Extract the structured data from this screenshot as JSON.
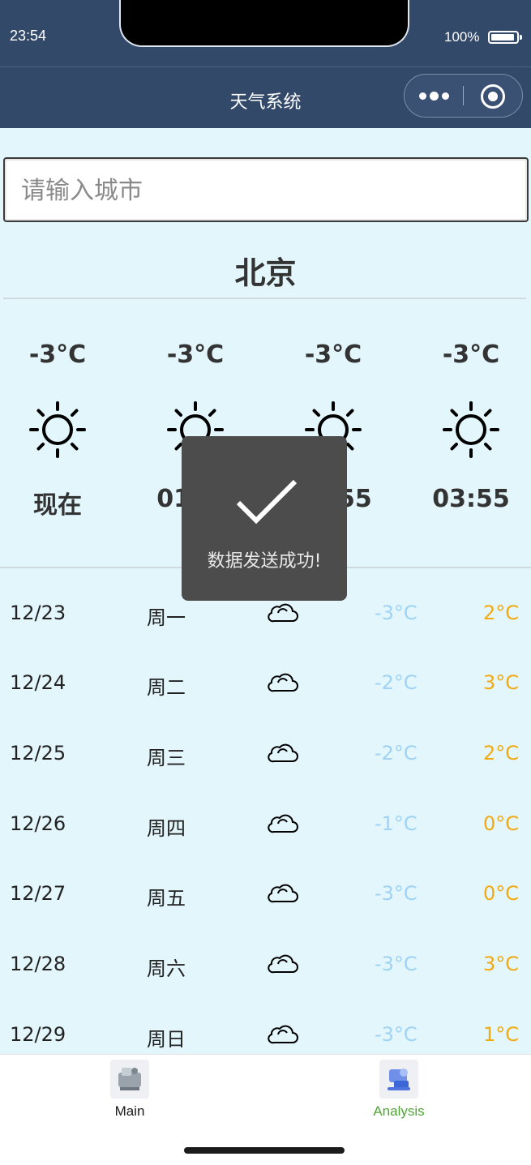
{
  "status_bar": {
    "time": "23:54",
    "battery": "100%"
  },
  "nav": {
    "title": "天气系统"
  },
  "search": {
    "placeholder": "请输入城市"
  },
  "city": "北京",
  "hourly": [
    {
      "temp": "-3°C",
      "icon": "sun-icon",
      "time": "现在"
    },
    {
      "temp": "-3°C",
      "icon": "sun-icon",
      "time": "01:55"
    },
    {
      "temp": "-3°C",
      "icon": "sun-icon",
      "time": "02:55"
    },
    {
      "temp": "-3°C",
      "icon": "sun-icon",
      "time": "03:55"
    }
  ],
  "daily": [
    {
      "date": "12/23",
      "weekday": "周一",
      "icon": "cloud-icon",
      "low": "-3°C",
      "high": "2°C"
    },
    {
      "date": "12/24",
      "weekday": "周二",
      "icon": "cloud-icon",
      "low": "-2°C",
      "high": "3°C"
    },
    {
      "date": "12/25",
      "weekday": "周三",
      "icon": "cloud-icon",
      "low": "-2°C",
      "high": "2°C"
    },
    {
      "date": "12/26",
      "weekday": "周四",
      "icon": "cloud-icon",
      "low": "-1°C",
      "high": "0°C"
    },
    {
      "date": "12/27",
      "weekday": "周五",
      "icon": "cloud-icon",
      "low": "-3°C",
      "high": "0°C"
    },
    {
      "date": "12/28",
      "weekday": "周六",
      "icon": "cloud-icon",
      "low": "-3°C",
      "high": "3°C"
    },
    {
      "date": "12/29",
      "weekday": "周日",
      "icon": "cloud-icon",
      "low": "-3°C",
      "high": "1°C"
    }
  ],
  "toast": {
    "message": "数据发送成功!"
  },
  "tabbar": [
    {
      "label": "Main",
      "icon": "main-tab-icon",
      "color": "#1a1a1a"
    },
    {
      "label": "Analysis",
      "icon": "analysis-tab-icon",
      "color": "#4fa535"
    }
  ],
  "colors": {
    "nav_bg": "#33496a",
    "page_bg": "#e2f6fb",
    "low_temp": "#9fd3f5",
    "high_temp": "#f1aa14",
    "active_tab": "#4fa535"
  }
}
